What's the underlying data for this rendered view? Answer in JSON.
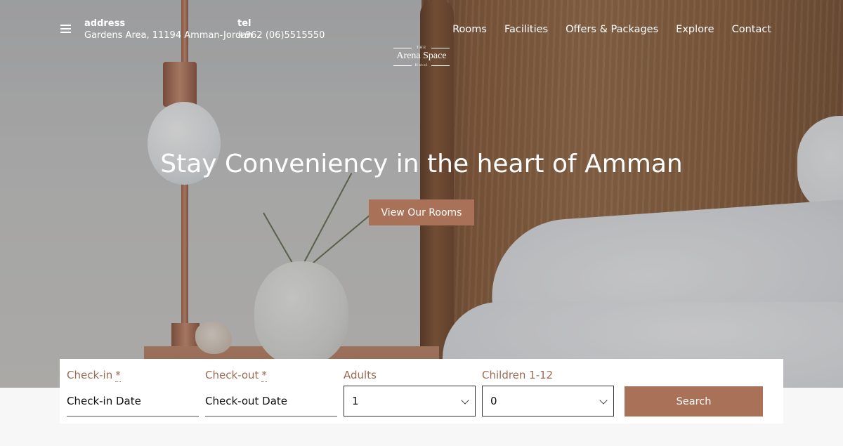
{
  "header": {
    "address_label": "address",
    "address_value": "Gardens Area, 11194 Amman-Jordan",
    "tel_label": "tel",
    "tel_value": "+962 (06)5515550",
    "logo_small": "THE",
    "logo_main": "Arena Space",
    "logo_sub": "Hotel"
  },
  "nav": [
    "Rooms",
    "Facilities",
    "Offers & Packages",
    "Explore",
    "Contact"
  ],
  "hero": {
    "headline": "Stay Conveniency in the heart of Amman",
    "cta_label": "View Our Rooms"
  },
  "booking": {
    "checkin_label": "Check-in",
    "checkin_required": "*",
    "checkin_placeholder": "Check-in Date",
    "checkout_label": "Check-out",
    "checkout_required": "*",
    "checkout_placeholder": "Check-out Date",
    "adults_label": "Adults",
    "adults_value": "1",
    "children_label": "Children 1-12",
    "children_value": "0",
    "search_label": "Search"
  },
  "colors": {
    "accent": "#a97157",
    "label": "#9c6a52"
  }
}
